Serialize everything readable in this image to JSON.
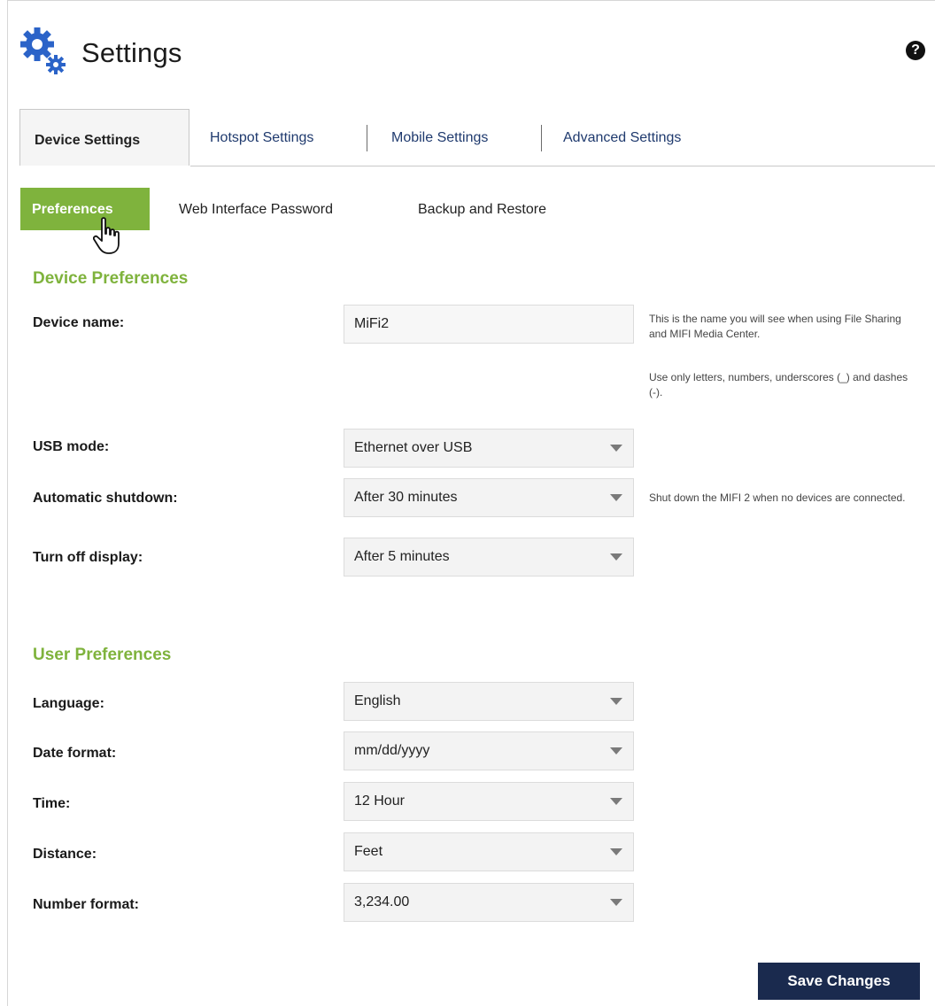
{
  "header": {
    "title": "Settings",
    "help_icon": "?"
  },
  "tabs": [
    {
      "label": "Device Settings",
      "active": true
    },
    {
      "label": "Hotspot Settings",
      "active": false
    },
    {
      "label": "Mobile Settings",
      "active": false
    },
    {
      "label": "Advanced Settings",
      "active": false
    }
  ],
  "subtabs": [
    {
      "label": "Preferences",
      "active": true
    },
    {
      "label": "Web Interface Password",
      "active": false
    },
    {
      "label": "Backup and Restore",
      "active": false
    }
  ],
  "device_prefs": {
    "title": "Device Preferences",
    "device_name": {
      "label": "Device name:",
      "value": "MiFi2",
      "hint1": "This is the name you will see when using File Sharing and MIFI Media Center.",
      "hint2": "Use only letters, numbers, underscores (_) and dashes (-)."
    },
    "usb_mode": {
      "label": "USB mode:",
      "value": "Ethernet over USB"
    },
    "auto_shutdown": {
      "label": "Automatic shutdown:",
      "value": "After 30 minutes",
      "hint": "Shut down the MIFI 2 when no devices are connected."
    },
    "display_off": {
      "label": "Turn off display:",
      "value": "After 5 minutes"
    }
  },
  "user_prefs": {
    "title": "User Preferences",
    "language": {
      "label": "Language:",
      "value": "English"
    },
    "date_format": {
      "label": "Date format:",
      "value": "mm/dd/yyyy"
    },
    "time": {
      "label": "Time:",
      "value": "12 Hour"
    },
    "distance": {
      "label": "Distance:",
      "value": "Feet"
    },
    "number_format": {
      "label": "Number format:",
      "value": "3,234.00"
    }
  },
  "save_label": "Save Changes",
  "colors": {
    "accent_green": "#7fb33d",
    "save_button": "#1a2a4e",
    "link_blue": "#1f3a6e",
    "gear_blue": "#2b63c8"
  }
}
